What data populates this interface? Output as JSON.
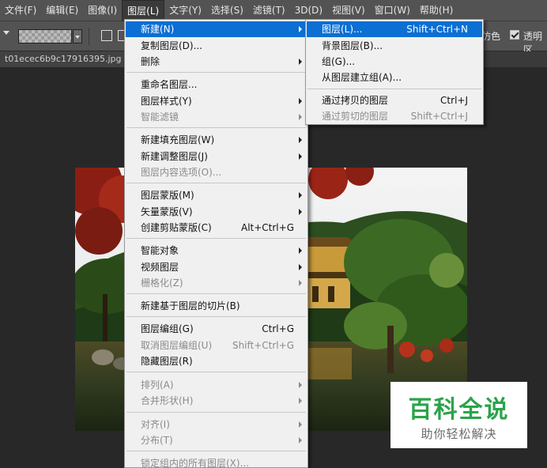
{
  "menubar": {
    "items": [
      "文件(F)",
      "编辑(E)",
      "图像(I)",
      "图层(L)",
      "文字(Y)",
      "选择(S)",
      "滤镜(T)",
      "3D(D)",
      "视图(V)",
      "窗口(W)",
      "帮助(H)"
    ],
    "active_index": 3
  },
  "options": {
    "dither_label": "仿色",
    "transparency_label": "透明区"
  },
  "document": {
    "tab_title": "t01ecec6b9c17916395.jpg @"
  },
  "layer_menu": {
    "items": [
      {
        "label": "新建(N)",
        "shortcut": "",
        "submenu": true,
        "disabled": false
      },
      {
        "label": "复制图层(D)...",
        "shortcut": "",
        "submenu": false,
        "disabled": false
      },
      {
        "label": "删除",
        "shortcut": "",
        "submenu": true,
        "disabled": false
      },
      {
        "label": "重命名图层...",
        "shortcut": "",
        "submenu": false,
        "disabled": false
      },
      {
        "label": "图层样式(Y)",
        "shortcut": "",
        "submenu": true,
        "disabled": false
      },
      {
        "label": "智能滤镜",
        "shortcut": "",
        "submenu": true,
        "disabled": true
      },
      {
        "label": "新建填充图层(W)",
        "shortcut": "",
        "submenu": true,
        "disabled": false
      },
      {
        "label": "新建调整图层(J)",
        "shortcut": "",
        "submenu": true,
        "disabled": false
      },
      {
        "label": "图层内容选项(O)...",
        "shortcut": "",
        "submenu": false,
        "disabled": true
      },
      {
        "label": "图层蒙版(M)",
        "shortcut": "",
        "submenu": true,
        "disabled": false
      },
      {
        "label": "矢量蒙版(V)",
        "shortcut": "",
        "submenu": true,
        "disabled": false
      },
      {
        "label": "创建剪贴蒙版(C)",
        "shortcut": "Alt+Ctrl+G",
        "submenu": false,
        "disabled": false
      },
      {
        "label": "智能对象",
        "shortcut": "",
        "submenu": true,
        "disabled": false
      },
      {
        "label": "视频图层",
        "shortcut": "",
        "submenu": true,
        "disabled": false
      },
      {
        "label": "栅格化(Z)",
        "shortcut": "",
        "submenu": true,
        "disabled": true
      },
      {
        "label": "新建基于图层的切片(B)",
        "shortcut": "",
        "submenu": false,
        "disabled": false
      },
      {
        "label": "图层编组(G)",
        "shortcut": "Ctrl+G",
        "submenu": false,
        "disabled": false
      },
      {
        "label": "取消图层编组(U)",
        "shortcut": "Shift+Ctrl+G",
        "submenu": false,
        "disabled": true
      },
      {
        "label": "隐藏图层(R)",
        "shortcut": "",
        "submenu": false,
        "disabled": false
      },
      {
        "label": "排列(A)",
        "shortcut": "",
        "submenu": true,
        "disabled": true
      },
      {
        "label": "合并形状(H)",
        "shortcut": "",
        "submenu": true,
        "disabled": true
      },
      {
        "label": "对齐(I)",
        "shortcut": "",
        "submenu": true,
        "disabled": true
      },
      {
        "label": "分布(T)",
        "shortcut": "",
        "submenu": true,
        "disabled": true
      },
      {
        "label": "锁定组内的所有图层(X)...",
        "shortcut": "",
        "submenu": false,
        "disabled": true
      }
    ]
  },
  "new_submenu": {
    "items": [
      {
        "label": "图层(L)...",
        "shortcut": "Shift+Ctrl+N",
        "disabled": false
      },
      {
        "label": "背景图层(B)...",
        "shortcut": "",
        "disabled": false
      },
      {
        "label": "组(G)...",
        "shortcut": "",
        "disabled": false
      },
      {
        "label": "从图层建立组(A)...",
        "shortcut": "",
        "disabled": false
      },
      {
        "label": "通过拷贝的图层",
        "shortcut": "Ctrl+J",
        "disabled": false
      },
      {
        "label": "通过剪切的图层",
        "shortcut": "Shift+Ctrl+J",
        "disabled": true
      }
    ]
  },
  "watermark": {
    "title": "百科全说",
    "subtitle": "助你轻松解决"
  },
  "colors": {
    "menu_highlight": "#0b6fd3",
    "watermark_green": "#2aa44a"
  }
}
